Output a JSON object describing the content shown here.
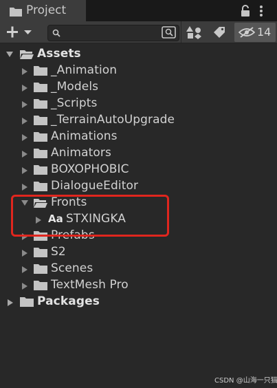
{
  "window": {
    "tab_title": "Project"
  },
  "toolbar": {
    "search_value": "",
    "hidden_count": "14"
  },
  "tree": {
    "root": "Assets",
    "children": [
      {
        "label": "_Animation"
      },
      {
        "label": "_Models"
      },
      {
        "label": "_Scripts"
      },
      {
        "label": "_TerrainAutoUpgrade"
      },
      {
        "label": "Animations"
      },
      {
        "label": "Animators"
      },
      {
        "label": "BOXOPHOBIC"
      },
      {
        "label": "DialogueEditor"
      },
      {
        "label": "Fronts"
      },
      {
        "label": "Prefabs"
      },
      {
        "label": "S2"
      },
      {
        "label": "Scenes"
      },
      {
        "label": "TextMesh Pro"
      }
    ],
    "fronts_child": {
      "glyph": "Aa",
      "label": "STXINGKA"
    },
    "packages": "Packages"
  },
  "annotation": {
    "highlight_color": "#e0261e"
  },
  "watermark": "CSDN @山海一只猫"
}
